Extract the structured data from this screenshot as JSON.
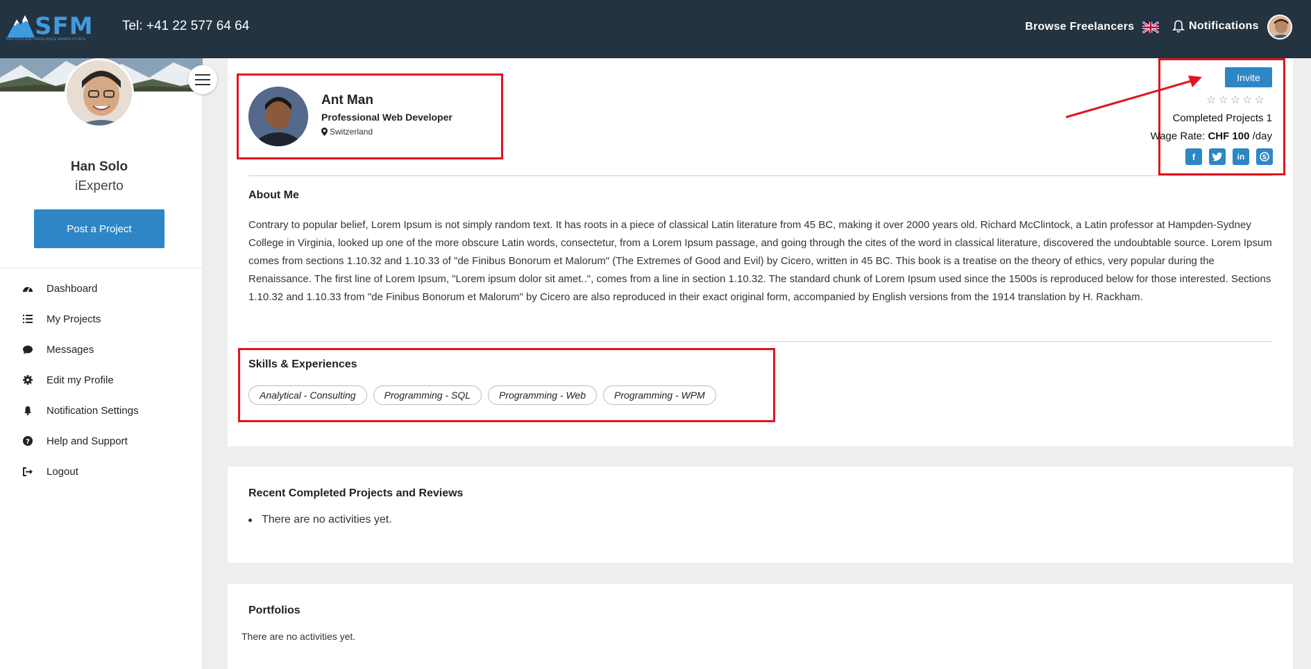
{
  "header": {
    "logo_text": "SFM",
    "logo_subtitle": "SWITZERLAND FREELANCE MARKETPLACE",
    "phone": "Tel: +41 22 577 64 64",
    "browse_label": "Browse Freelancers",
    "notifications_label": "Notifications",
    "language_icon": "uk-flag-icon",
    "bell_icon": "bell-icon"
  },
  "sidebar": {
    "user_name": "Han Solo",
    "user_role": "iExperto",
    "post_button": "Post a Project",
    "items": [
      {
        "label": "Dashboard",
        "icon": "dashboard-icon"
      },
      {
        "label": "My Projects",
        "icon": "list-icon"
      },
      {
        "label": "Messages",
        "icon": "comment-icon"
      },
      {
        "label": "Edit my Profile",
        "icon": "gear-icon"
      },
      {
        "label": "Notification Settings",
        "icon": "bell-icon"
      },
      {
        "label": "Help and Support",
        "icon": "question-icon"
      },
      {
        "label": "Logout",
        "icon": "sign-out-icon"
      }
    ]
  },
  "profile": {
    "name": "Ant Man",
    "title": "Professional Web Developer",
    "location": "Switzerland",
    "invite_button": "Invite",
    "rating": 0,
    "rating_max": 5,
    "completed_label": "Completed Projects 1",
    "wage_prefix": "Wage Rate: ",
    "wage_value": "CHF 100",
    "wage_suffix": " /day",
    "socials": [
      "facebook",
      "twitter",
      "linkedin",
      "skype"
    ]
  },
  "about": {
    "title": "About Me",
    "text": "Contrary to popular belief, Lorem Ipsum is not simply random text. It has roots in a piece of classical Latin literature from 45 BC, making it over 2000 years old. Richard McClintock, a Latin professor at Hampden-Sydney College in Virginia, looked up one of the more obscure Latin words, consectetur, from a Lorem Ipsum passage, and going through the cites of the word in classical literature, discovered the undoubtable source. Lorem Ipsum comes from sections 1.10.32 and 1.10.33 of \"de Finibus Bonorum et Malorum\" (The Extremes of Good and Evil) by Cicero, written in 45 BC. This book is a treatise on the theory of ethics, very popular during the Renaissance. The first line of Lorem Ipsum, \"Lorem ipsum dolor sit amet..\", comes from a line in section 1.10.32. The standard chunk of Lorem Ipsum used since the 1500s is reproduced below for those interested. Sections 1.10.32 and 1.10.33 from \"de Finibus Bonorum et Malorum\" by Cicero are also reproduced in their exact original form, accompanied by English versions from the 1914 translation by H. Rackham."
  },
  "skills": {
    "title": "Skills & Experiences",
    "tags": [
      "Analytical - Consulting",
      "Programming - SQL",
      "Programming - Web",
      "Programming - WPM"
    ]
  },
  "recent": {
    "title": "Recent Completed Projects and Reviews",
    "empty": "There are no activities yet."
  },
  "portfolios": {
    "title": "Portfolios",
    "empty": "There are no activities yet."
  },
  "colors": {
    "header_bg": "#243340",
    "accent": "#2e86c6",
    "highlight": "#e0141e"
  }
}
